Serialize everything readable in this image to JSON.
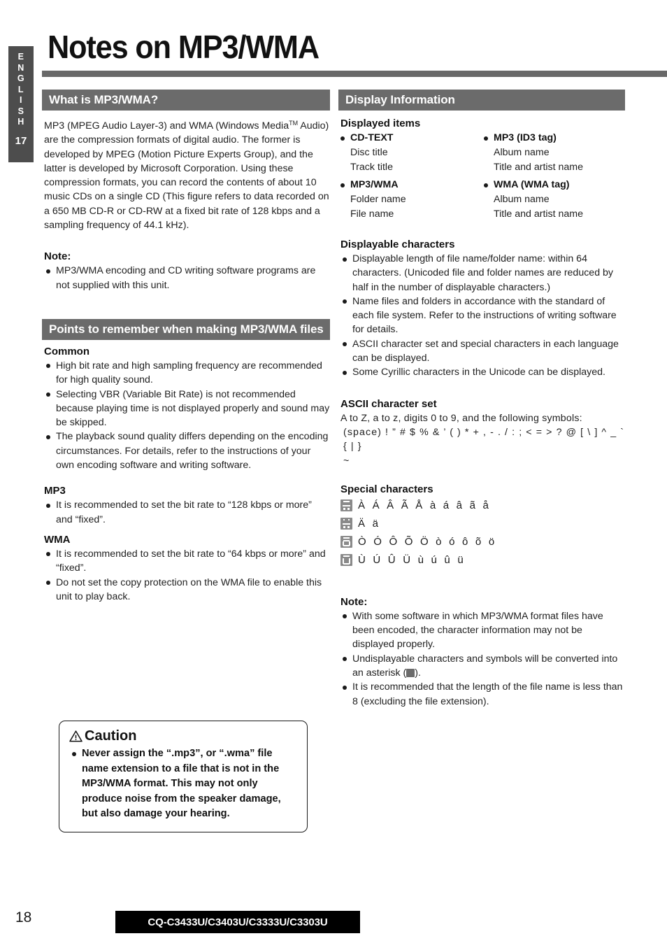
{
  "sidebar": {
    "language_letters": [
      "E",
      "N",
      "G",
      "L",
      "I",
      "S",
      "H"
    ],
    "section_number": "17"
  },
  "title": "Notes on MP3/WMA",
  "left_column": {
    "section1": {
      "header": "What is MP3/WMA?",
      "paragraph": "MP3 (MPEG Audio Layer-3) and WMA (Windows Media™ Audio) are the compression formats of digital audio. The former is developed by MPEG (Motion Picture Experts Group), and the latter is developed by Microsoft Corporation. Using these compression formats, you can record the contents of about 10 music CDs on a single CD (This figure refers to data recorded on a 650 MB CD-R or CD-RW at a fixed bit rate of 128 kbps and a sampling frequency of 44.1 kHz).",
      "note_label": "Note:",
      "note_items": [
        "MP3/WMA encoding and CD writing software programs are not supplied with this unit."
      ]
    },
    "section2": {
      "header": "Points to remember when making MP3/WMA files",
      "groups": [
        {
          "title": "Common",
          "items": [
            "High bit rate and high sampling frequency are recommended for high quality sound.",
            "Selecting VBR (Variable Bit Rate) is not recommended because playing time is not displayed properly and sound may be skipped.",
            "The playback sound quality differs depending on the encoding circumstances. For details, refer to the instructions of your own encoding software and writing software."
          ]
        },
        {
          "title": "MP3",
          "items": [
            "It is recommended to set the bit rate to “128 kbps or more” and “fixed”."
          ]
        },
        {
          "title": "WMA",
          "items": [
            "It is recommended to set the bit rate to “64 kbps or more” and “fixed”.",
            "Do not set the copy protection on the WMA file to enable this unit to play back."
          ]
        }
      ]
    },
    "caution": {
      "title": "Caution",
      "icon": "warning-triangle-icon",
      "items": [
        "Never assign the “.mp3”, or “.wma” file name extension to a file that is not in the MP3/WMA format. This may not only produce noise from the speaker damage, but also damage your hearing."
      ]
    }
  },
  "right_column": {
    "section_header": "Display Information",
    "displayed_items": {
      "title": "Displayed items",
      "columns": [
        [
          {
            "head": "CD-TEXT",
            "subs": [
              "Disc title",
              "Track title"
            ]
          },
          {
            "head": "MP3/WMA",
            "subs": [
              "Folder name",
              "File name"
            ]
          }
        ],
        [
          {
            "head": "MP3 (ID3 tag)",
            "subs": [
              "Album name",
              "Title and artist name"
            ]
          },
          {
            "head": "WMA (WMA tag)",
            "subs": [
              "Album name",
              "Title and artist name"
            ]
          }
        ]
      ]
    },
    "displayable_characters": {
      "title": "Displayable characters",
      "items": [
        "Displayable length of file name/folder name: within 64 characters. (Unicoded file and folder names are reduced by half in the number of displayable characters.)",
        "Name files and folders in accordance with the standard of each file system. Refer to the instructions of writing software for details.",
        "ASCII character set and special characters in each language can be displayed.",
        "Some Cyrillic characters in the Unicode can be displayed."
      ]
    },
    "ascii": {
      "title": "ASCII character set",
      "line1": "A to Z, a to z, digits 0 to 9, and the following symbols:",
      "line2": "(space) ! ” # $ % & ’ ( )  * + , - . / : ; < = > ? @ [ \\ ] ^ _ ` { | }",
      "line3": "~"
    },
    "special_characters": {
      "title": "Special characters",
      "rows": [
        {
          "icon": "lcd-char-icon-a",
          "chars": "À Á Â Ã Å à á â ã å"
        },
        {
          "icon": "lcd-char-icon-a-umlaut",
          "chars": "Ä ä"
        },
        {
          "icon": "lcd-char-icon-o",
          "chars": "Ò Ó Ô Õ Ö ò ó ô õ ö"
        },
        {
          "icon": "lcd-char-icon-u",
          "chars": "Ù Ú Û Ü ù ú û ü"
        }
      ]
    },
    "note": {
      "label": "Note:",
      "items": [
        "With some software in which MP3/WMA format files have been encoded, the character information may not be displayed properly.",
        "Undisplayable characters and symbols will be converted into an asterisk (█).",
        "It is recommended that the length of the file name is less than 8 (excluding the file extension)."
      ]
    }
  },
  "footer": {
    "page_number": "18",
    "model": "CQ-C3433U/C3403U/C3333U/C3303U"
  }
}
